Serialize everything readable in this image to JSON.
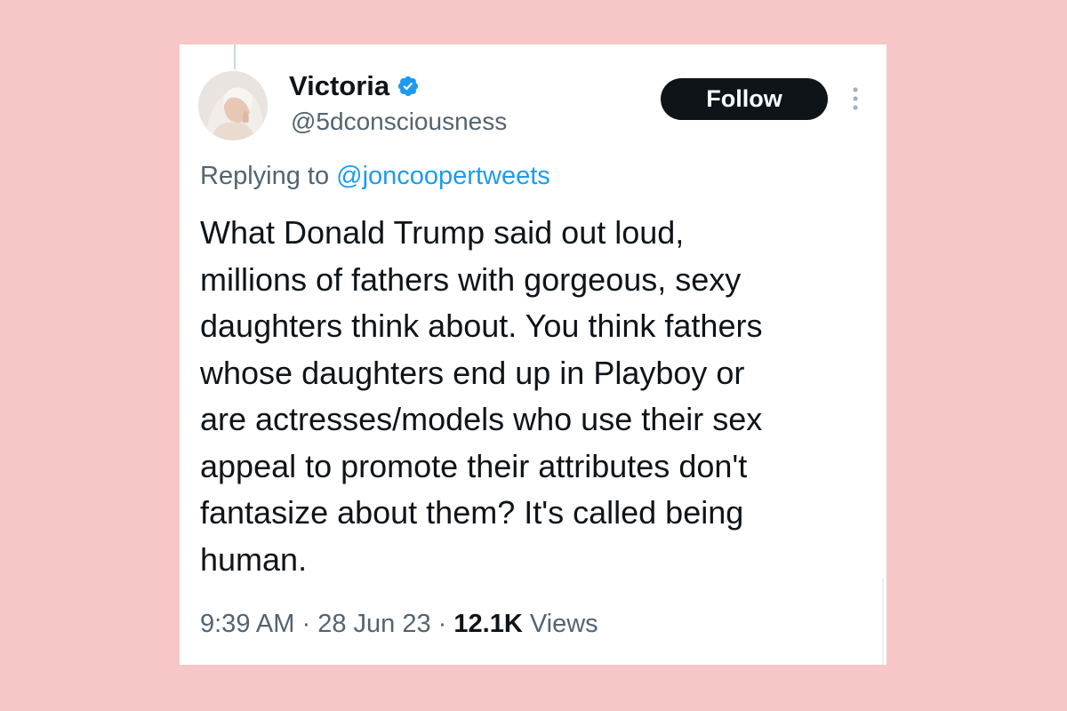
{
  "tweet": {
    "author": {
      "display_name": "Victoria",
      "handle": "@5dconsciousness",
      "avatar_icon": "profile-photo",
      "verified_icon": "verified-badge-icon"
    },
    "follow_label": "Follow",
    "more_icon": "more-options-icon",
    "reply_prefix": "Replying to",
    "reply_handle": "@joncoopertweets",
    "text_lines": [
      "What Donald Trump said out loud,",
      "millions of fathers with gorgeous, sexy",
      "daughters think about. You think fathers",
      "whose daughters end up in Playboy or",
      "are actresses/models who use their sex",
      "appeal to promote their attributes don't",
      "fantasize about them? It's called being",
      "human."
    ],
    "time": "9:39 AM",
    "date": "28 Jun 23",
    "separator": "·",
    "views_count": "12.1K",
    "views_label": "Views"
  },
  "colors": {
    "page_background": "#f7c7c7",
    "card_background": "#ffffff",
    "primary_text": "#0f1419",
    "secondary_text": "#536471",
    "link": "#1d9bf0",
    "verified": "#1d9bf0"
  }
}
